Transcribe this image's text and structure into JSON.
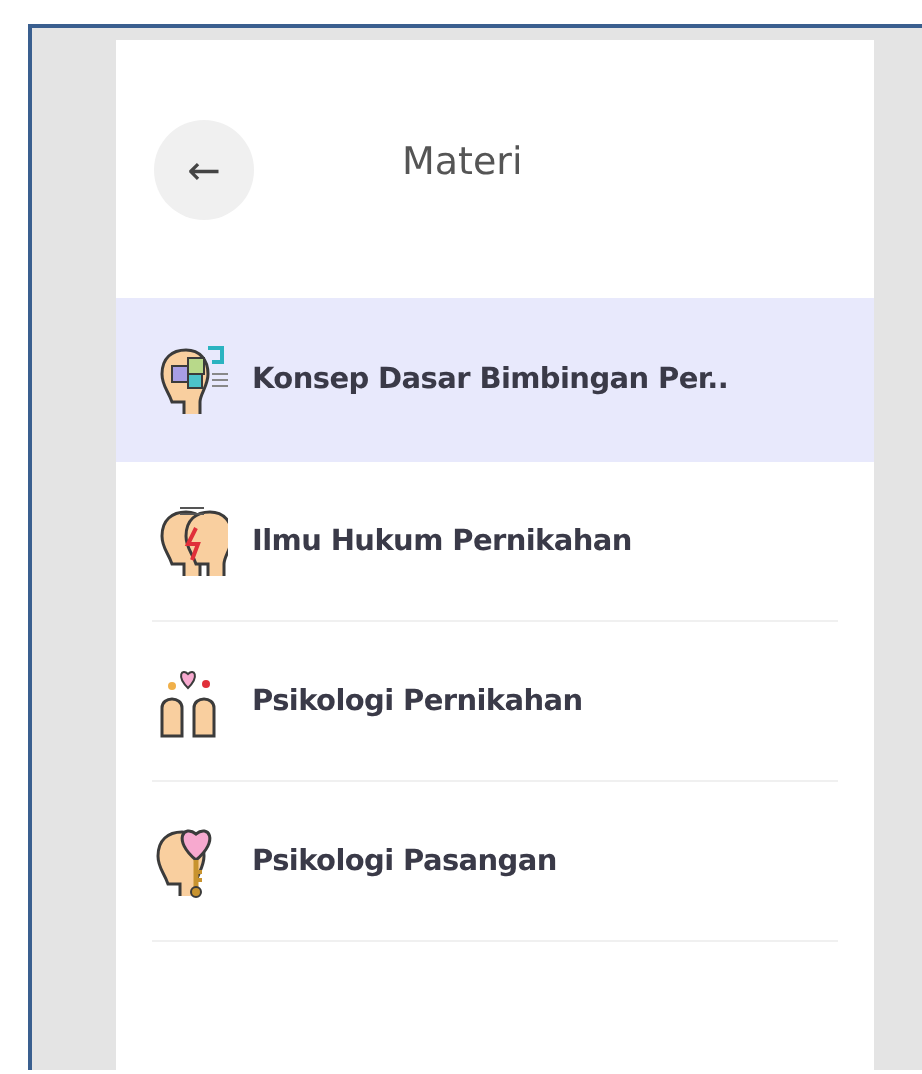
{
  "header": {
    "back_icon": "←",
    "title": "Materi"
  },
  "items": [
    {
      "label": "Konsep  Dasar Bimbingan Per..",
      "kind": "puzzle",
      "selected": true
    },
    {
      "label": "Ilmu Hukum Pernikahan",
      "kind": "conflict",
      "selected": false
    },
    {
      "label": "Psikologi Pernikahan",
      "kind": "love",
      "selected": false
    },
    {
      "label": "Psikologi Pasangan",
      "kind": "key",
      "selected": false
    }
  ]
}
